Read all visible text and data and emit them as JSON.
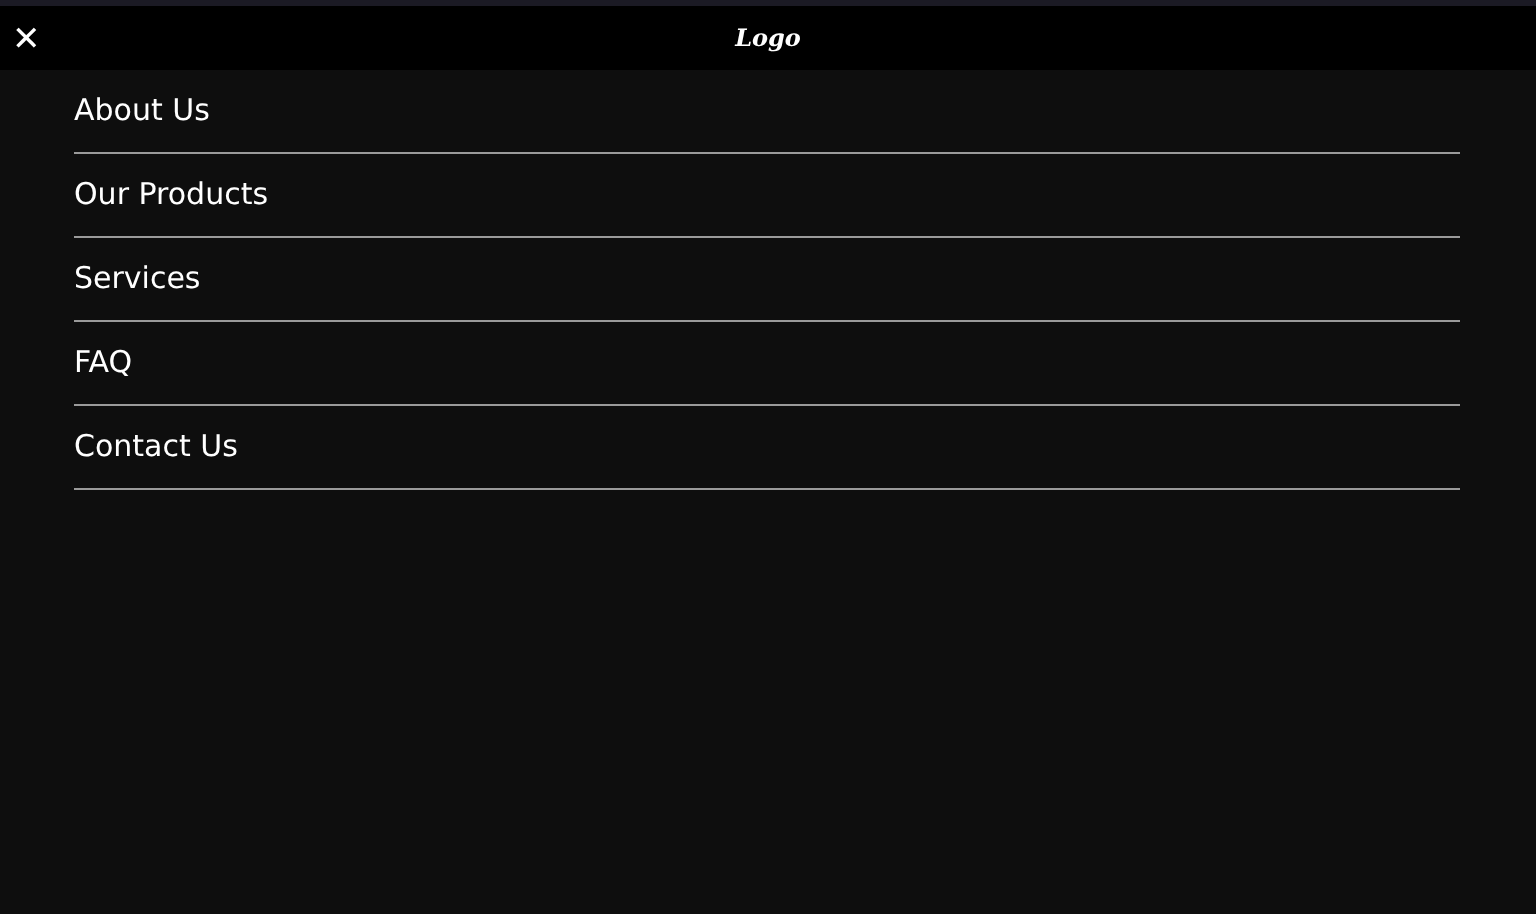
{
  "header": {
    "close": "✕",
    "logo": "Logo"
  },
  "menu": [
    {
      "label": "About Us"
    },
    {
      "label": "Our Products"
    },
    {
      "label": "Services"
    },
    {
      "label": "FAQ"
    },
    {
      "label": "Contact Us"
    }
  ]
}
